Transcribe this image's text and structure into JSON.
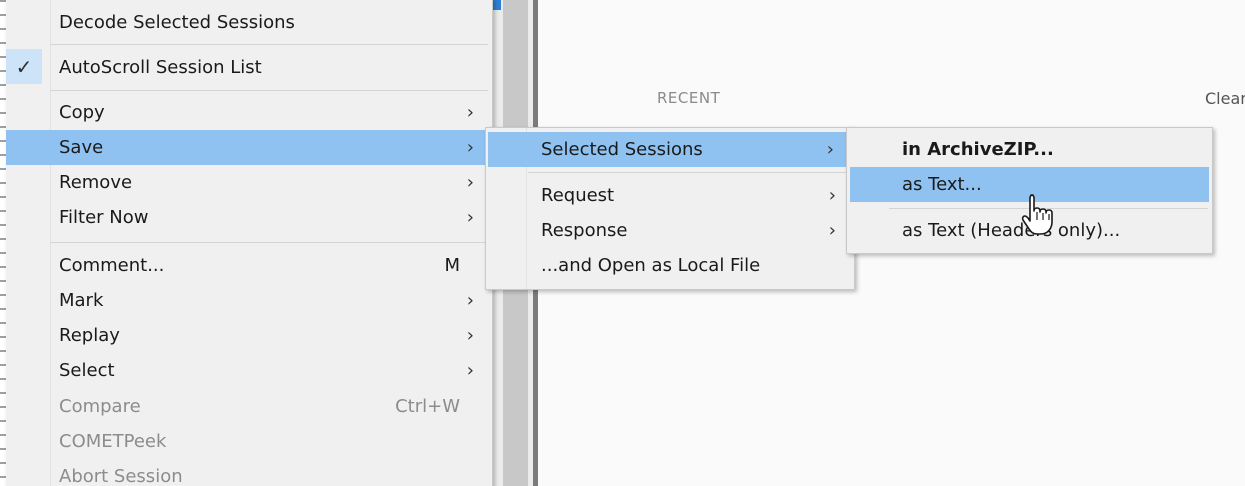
{
  "background": {
    "recent_label": "RECENT",
    "clear_label": "Clear"
  },
  "context_menu": {
    "items": [
      {
        "label": "Decode Selected Sessions"
      },
      {
        "label": "AutoScroll Session List",
        "checked": true
      },
      {
        "label": "Copy",
        "submenu": true
      },
      {
        "label": "Save",
        "submenu": true,
        "highlighted": true
      },
      {
        "label": "Remove",
        "submenu": true
      },
      {
        "label": "Filter Now",
        "submenu": true
      },
      {
        "label": "Comment...",
        "shortcut": "M"
      },
      {
        "label": "Mark",
        "submenu": true
      },
      {
        "label": "Replay",
        "submenu": true
      },
      {
        "label": "Select",
        "submenu": true
      },
      {
        "label": "Compare",
        "shortcut": "Ctrl+W",
        "disabled": true
      },
      {
        "label": "COMETPeek",
        "disabled": true
      },
      {
        "label": "Abort Session",
        "disabled": true
      }
    ],
    "arrow_glyph": "›",
    "check_glyph": "✓"
  },
  "save_submenu": {
    "items": [
      {
        "label": "Selected Sessions",
        "submenu": true,
        "highlighted": true
      },
      {
        "label": "Request",
        "submenu": true
      },
      {
        "label": "Response",
        "submenu": true
      },
      {
        "label": "...and Open as Local File"
      }
    ]
  },
  "selected_sessions_submenu": {
    "items": [
      {
        "label": "in ArchiveZIP...",
        "bold": true
      },
      {
        "label": "as Text...",
        "highlighted": true
      },
      {
        "label": "as Text (Headers only)..."
      }
    ]
  },
  "colors": {
    "highlight": "#8fc2f0",
    "menu_bg": "#f0f0f0",
    "disabled_text": "#8c8c8c"
  },
  "icons": {
    "pointer": "hand-pointer-icon",
    "check": "checkmark-icon",
    "submenu": "chevron-right-icon"
  }
}
